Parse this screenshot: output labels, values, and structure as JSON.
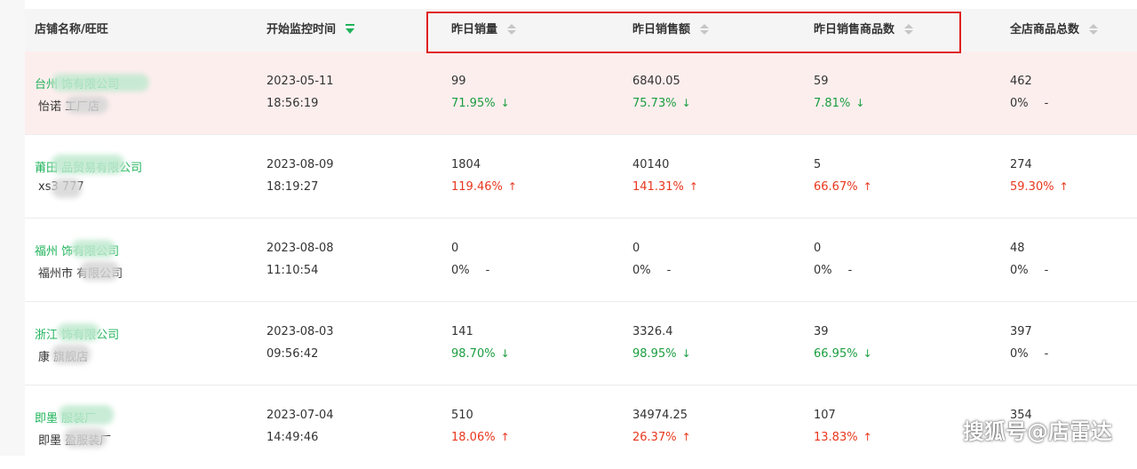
{
  "colors": {
    "header_bg": "#f5f5f5",
    "highlight_row_bg": "#fdeeee",
    "shop_link": "#1fb35a",
    "up": "#e8371e",
    "down": "#1a9e3f",
    "box_border": "#e02020"
  },
  "columns": [
    {
      "label": "店铺名称/旺旺",
      "sort": "none"
    },
    {
      "label": "开始监控时间",
      "sort": "desc-active"
    },
    {
      "label": "昨日销量",
      "sort": "both"
    },
    {
      "label": "昨日销售额",
      "sort": "both"
    },
    {
      "label": "昨日销售商品数",
      "sort": "both"
    },
    {
      "label": "全店商品总数",
      "sort": "both"
    }
  ],
  "rows": [
    {
      "shop": "台州 饰有限公司",
      "wangwang": "怡诺 工厂店",
      "date": "2023-05-11",
      "time": "18:56:19",
      "sales": {
        "value": "99",
        "pct": "71.95%",
        "dir": "down"
      },
      "revenue": {
        "value": "6840.05",
        "pct": "75.73%",
        "dir": "down"
      },
      "items": {
        "value": "59",
        "pct": "7.81%",
        "dir": "down"
      },
      "total": {
        "value": "462",
        "pct": "0%",
        "dir": "flat"
      }
    },
    {
      "shop": "莆田 品贸易有限公司",
      "wangwang": "xs3 777",
      "date": "2023-08-09",
      "time": "18:19:27",
      "sales": {
        "value": "1804",
        "pct": "119.46%",
        "dir": "up"
      },
      "revenue": {
        "value": "40140",
        "pct": "141.31%",
        "dir": "up"
      },
      "items": {
        "value": "5",
        "pct": "66.67%",
        "dir": "up"
      },
      "total": {
        "value": "274",
        "pct": "59.30%",
        "dir": "up"
      }
    },
    {
      "shop": "福州 饰有限公司",
      "wangwang": "福州市 有限公司",
      "date": "2023-08-08",
      "time": "11:10:54",
      "sales": {
        "value": "0",
        "pct": "0%",
        "dir": "flat"
      },
      "revenue": {
        "value": "0",
        "pct": "0%",
        "dir": "flat"
      },
      "items": {
        "value": "0",
        "pct": "0%",
        "dir": "flat"
      },
      "total": {
        "value": "48",
        "pct": "0%",
        "dir": "flat"
      }
    },
    {
      "shop": "浙江 饰有限公司",
      "wangwang": "康 旗舰店",
      "date": "2023-08-03",
      "time": "09:56:42",
      "sales": {
        "value": "141",
        "pct": "98.70%",
        "dir": "down"
      },
      "revenue": {
        "value": "3326.4",
        "pct": "98.95%",
        "dir": "down"
      },
      "items": {
        "value": "39",
        "pct": "66.95%",
        "dir": "down"
      },
      "total": {
        "value": "397",
        "pct": "0%",
        "dir": "flat"
      }
    },
    {
      "shop": "即墨 服装厂",
      "wangwang": "即墨 盈服装厂",
      "date": "2023-07-04",
      "time": "14:49:46",
      "sales": {
        "value": "510",
        "pct": "18.06%",
        "dir": "up"
      },
      "revenue": {
        "value": "34974.25",
        "pct": "26.37%",
        "dir": "up"
      },
      "items": {
        "value": "107",
        "pct": "13.83%",
        "dir": "up"
      },
      "total": {
        "value": "354",
        "pct": "",
        "dir": "none"
      }
    }
  ],
  "watermark": "搜狐号@店雷达",
  "glyphs": {
    "up": "↑",
    "down": "↓",
    "flat": "-"
  }
}
